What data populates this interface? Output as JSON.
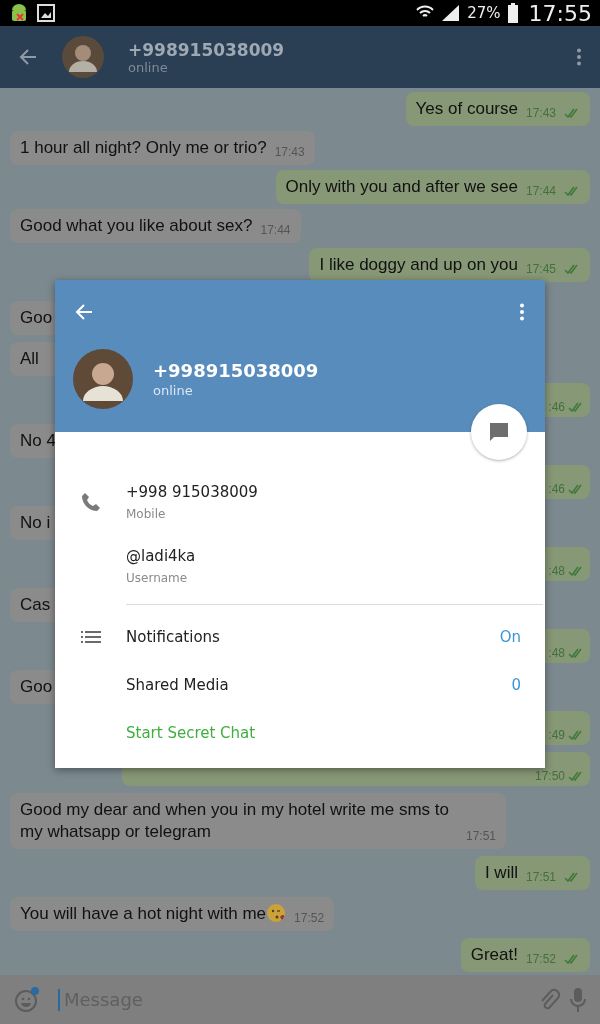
{
  "status_bar": {
    "battery": "27%",
    "time": "17:55"
  },
  "chat_header": {
    "title": "+998915038009",
    "status": "online"
  },
  "messages": [
    {
      "kind": "out",
      "text": "Yes of course",
      "time": "17:43"
    },
    {
      "kind": "in",
      "text": "1 hour all night? Only me or trio?",
      "time": "17:43"
    },
    {
      "kind": "out",
      "text": "Only with you and after we see",
      "time": "17:44"
    },
    {
      "kind": "in",
      "text": "Good what you like about sex?",
      "time": "17:44"
    },
    {
      "kind": "out",
      "text": "I like doggy and up on you",
      "time": "17:45"
    },
    {
      "kind": "in_covered",
      "text": "Goo"
    },
    {
      "kind": "in_covered",
      "text": "All"
    },
    {
      "kind": "out_covered",
      "time": ":46"
    },
    {
      "kind": "in_covered",
      "text": "No 4"
    },
    {
      "kind": "out_covered",
      "time": ":46"
    },
    {
      "kind": "in_covered",
      "text": "No i"
    },
    {
      "kind": "out_covered",
      "time": ":48"
    },
    {
      "kind": "in_covered",
      "text": "Cas"
    },
    {
      "kind": "out_covered",
      "time": ":48"
    },
    {
      "kind": "in_covered",
      "text": "Goo"
    },
    {
      "kind": "out_covered",
      "time": ":49"
    },
    {
      "kind": "out_covered_wide",
      "time": "17:50"
    },
    {
      "kind": "in",
      "text": "Good my dear and when you in my hotel write me sms to my whatsapp or telegram",
      "time": "17:51"
    },
    {
      "kind": "out",
      "text": "I will",
      "time": "17:51"
    },
    {
      "kind": "in",
      "text": "You will have a hot night with me",
      "time": "17:52",
      "emoji": true
    },
    {
      "kind": "out",
      "text": "Great!",
      "time": "17:52"
    }
  ],
  "input": {
    "placeholder": "Message"
  },
  "profile_dialog": {
    "name": "+998915038009",
    "status": "online",
    "info": [
      {
        "kind": "phone",
        "value": "+998 915038009",
        "label": "Mobile"
      },
      {
        "kind": "username",
        "value": "@ladi4ka",
        "label": "Username"
      }
    ],
    "settings": [
      {
        "kind": "notifications",
        "label": "Notifications",
        "value": "On"
      },
      {
        "kind": "media",
        "label": "Shared Media",
        "value": "0"
      }
    ],
    "action": "Start Secret Chat"
  }
}
